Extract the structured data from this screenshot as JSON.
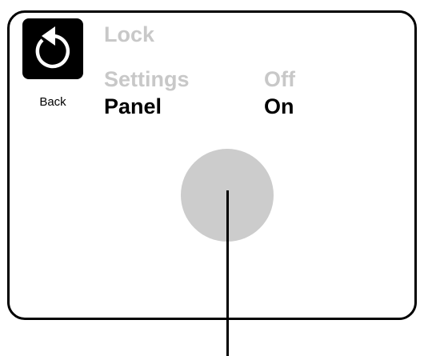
{
  "back_button": {
    "icon": "undo-arrow-icon",
    "label": "Back"
  },
  "menu": {
    "title": "Lock",
    "rows": [
      {
        "label": "Settings",
        "value": "Off",
        "state": "inactive"
      },
      {
        "label": "Panel",
        "value": "On",
        "state": "active"
      }
    ]
  },
  "colors": {
    "active_text": "#000000",
    "inactive_text": "#c8c8c8",
    "touch_indicator": "#cccccc",
    "frame": "#000000"
  }
}
